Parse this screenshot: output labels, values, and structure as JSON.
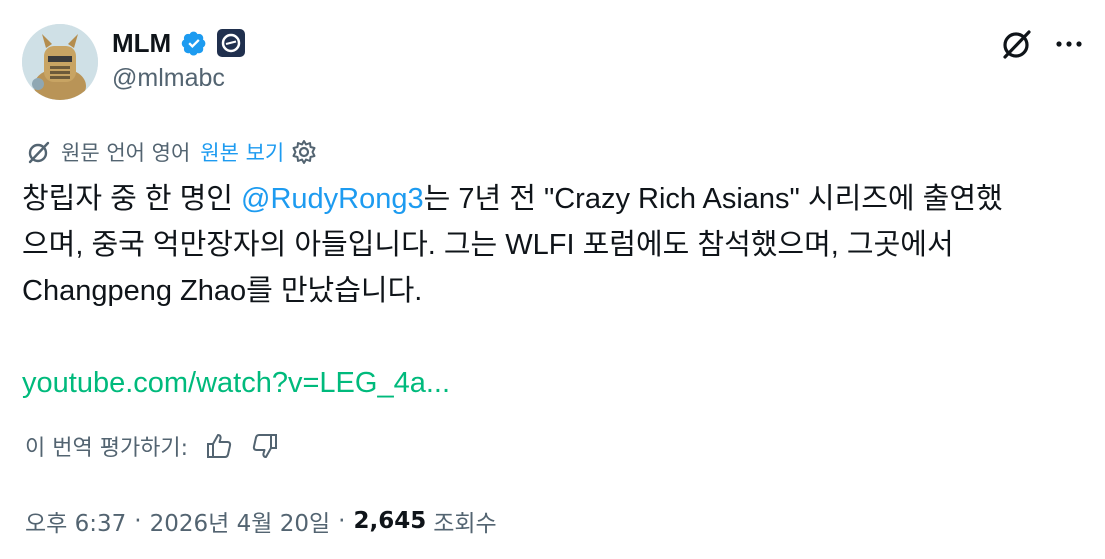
{
  "author": {
    "display_name": "MLM",
    "handle": "@mlmabc",
    "verified_icon": "verified-badge-icon",
    "affiliate_icon": "affiliate-badge-icon",
    "verified_color": "#1d9bf0"
  },
  "translation": {
    "label": "원문 언어 영어",
    "show_original": "원본 보기"
  },
  "post": {
    "line1_before": "창립자 중 한 명인 ",
    "mention": "@RudyRong3",
    "line1_after": "는 7년 전 \"Crazy Rich Asians\" 시리즈에 출연했",
    "line2": "으며, 중국 억만장자의 아들입니다. 그는 WLFI 포럼에도 참석했으며, 그곳에서",
    "line3": "Changpeng Zhao를 만났습니다.",
    "link_text": "youtube.com/watch?v=LEG_4a..."
  },
  "rating": {
    "label": "이 번역 평가하기:"
  },
  "meta": {
    "time": "오후 6:37",
    "date": "2026년 4월 20일",
    "separator": "·",
    "views_count": "2,645",
    "views_label": "조회수"
  },
  "colors": {
    "link_blue": "#1d9bf0",
    "url_green": "#00ba7c",
    "secondary_text": "#536471"
  }
}
